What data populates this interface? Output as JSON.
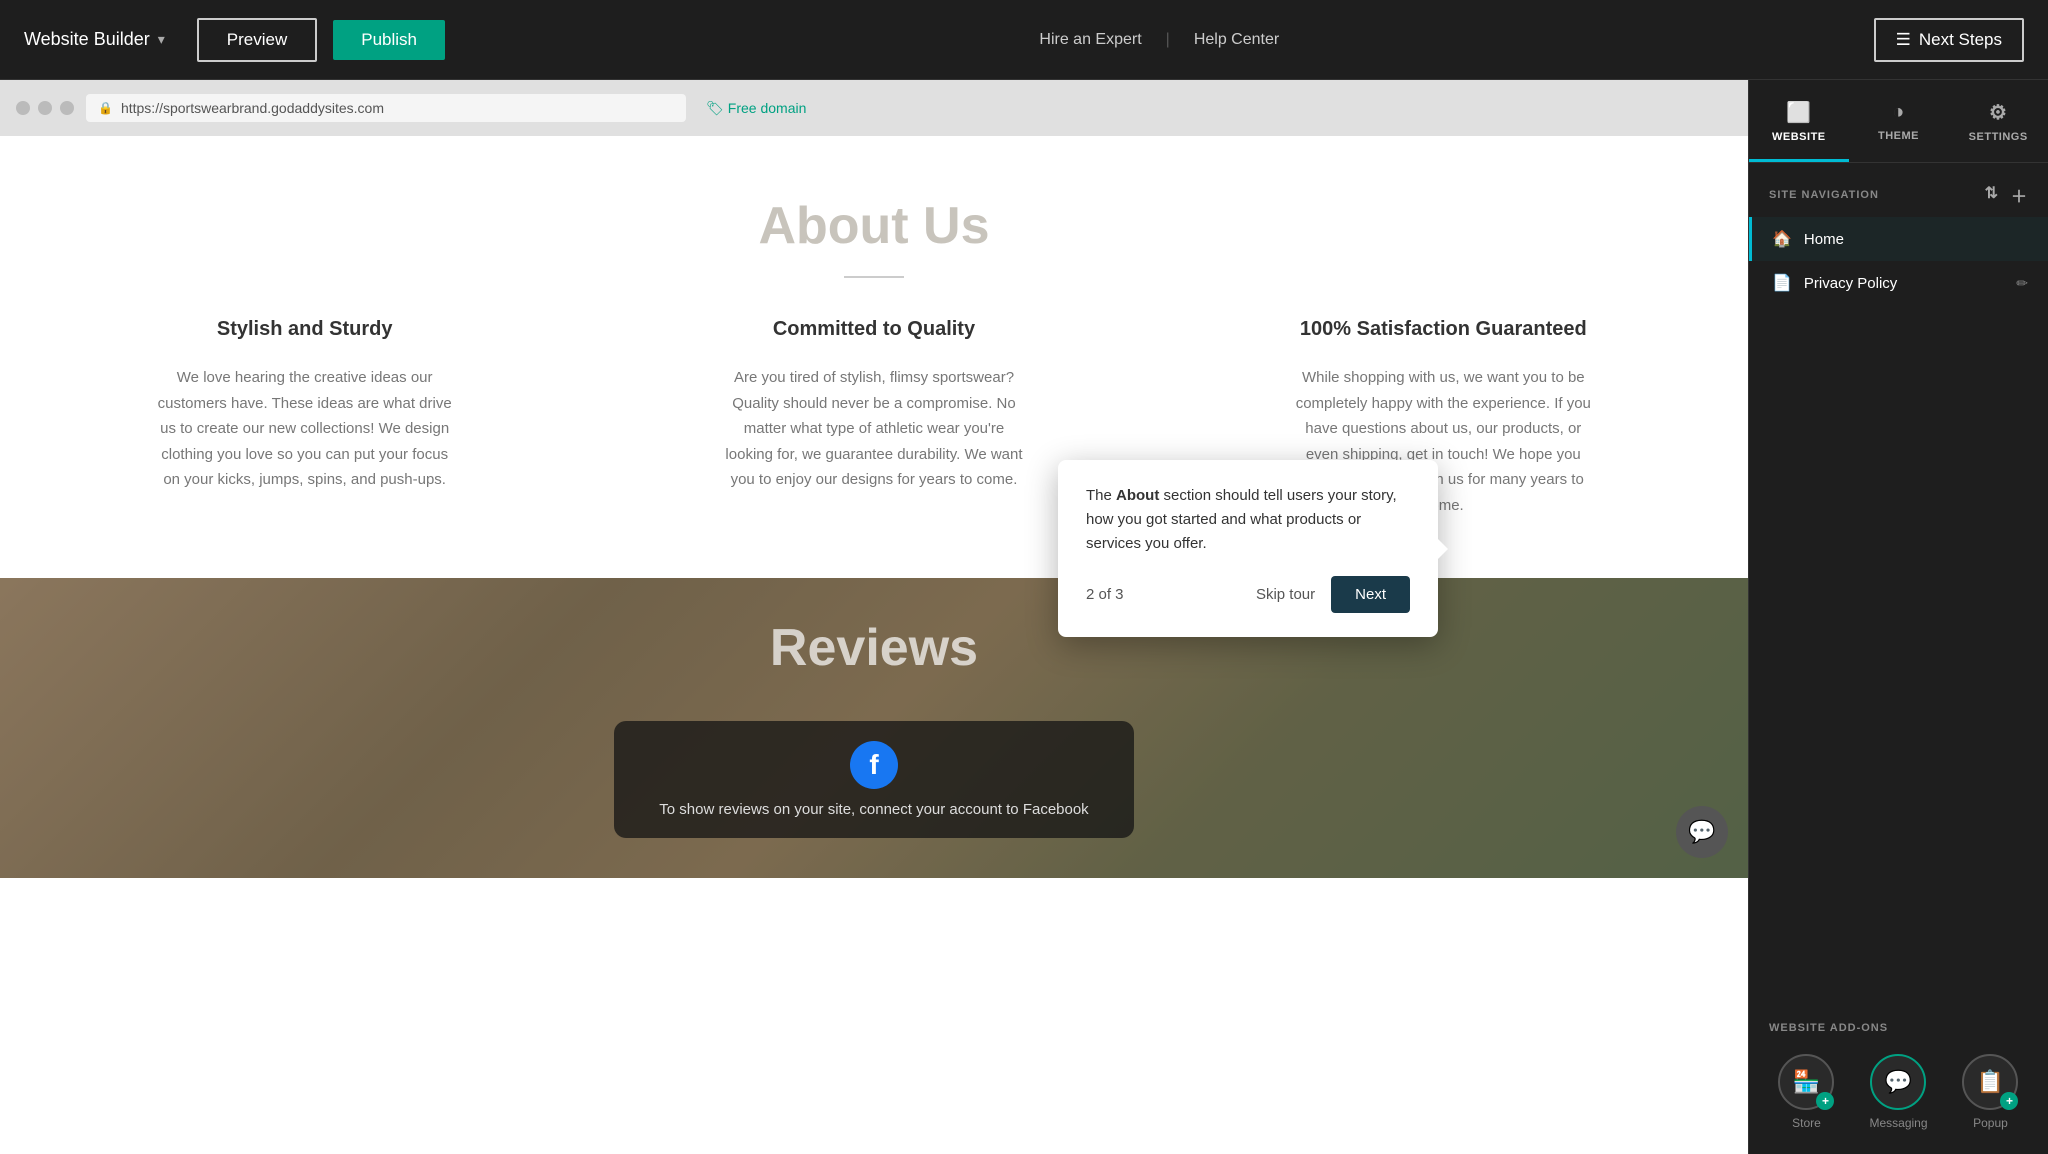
{
  "topbar": {
    "brand_label": "Website Builder",
    "preview_label": "Preview",
    "publish_label": "Publish",
    "hire_expert_label": "Hire an Expert",
    "divider": "|",
    "help_center_label": "Help Center",
    "next_steps_label": "Next Steps",
    "next_steps_icon": "☰"
  },
  "browser": {
    "url": "https://sportswearbrand.godaddysites.com",
    "free_domain_label": "Free domain",
    "free_domain_icon": "🏷"
  },
  "about_section": {
    "title": "About Us",
    "columns": [
      {
        "heading": "Stylish and Sturdy",
        "text": "We love hearing the creative ideas our customers have. These ideas are what drive us to create our new collections! We design clothing you love so you can put your focus on your kicks, jumps, spins, and push-ups."
      },
      {
        "heading": "Committed to Quality",
        "text": "Are you tired of stylish, flimsy sportswear? Quality should never be a compromise. No matter what type of athletic wear you're looking for, we guarantee durability. We want you to enjoy our designs for years to come."
      },
      {
        "heading": "100% Satisfaction Guaranteed",
        "text": "While shopping with us, we want you to be completely happy with the experience. If you have questions about us, our products, or even shipping, get in touch! We hope you continue to shop with us for many years to come."
      }
    ]
  },
  "reviews_section": {
    "title": "Reviews",
    "facebook_text": "To show reviews on your site, connect your account to Facebook"
  },
  "sidebar": {
    "tabs": [
      {
        "label": "WEBSITE",
        "icon": "⬜",
        "active": true
      },
      {
        "label": "THEME",
        "icon": "◑",
        "active": false
      },
      {
        "label": "SETTINGS",
        "icon": "⚙",
        "active": false
      }
    ],
    "site_navigation_label": "SITE NAVIGATION",
    "nav_items": [
      {
        "label": "Home",
        "icon": "🏠",
        "active": true
      },
      {
        "label": "Privacy Policy",
        "icon": "📄",
        "active": false,
        "has_edit": true
      }
    ],
    "website_addons_label": "WEBSITE ADD-ONS",
    "addons": [
      {
        "label": "Store",
        "icon": "🏪",
        "plus": false
      },
      {
        "label": "Messaging",
        "icon": "💬",
        "plus": false,
        "highlighted": true
      },
      {
        "label": "Popup",
        "icon": "📋",
        "plus": true
      }
    ]
  },
  "tooltip": {
    "text_before_bold": "The ",
    "bold_text": "About",
    "text_after_bold": " section should tell users your story, how you got started and what products or services you offer.",
    "progress": "2 of 3",
    "skip_label": "Skip tour",
    "next_label": "Next"
  }
}
